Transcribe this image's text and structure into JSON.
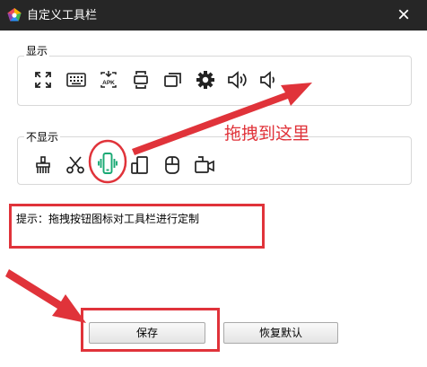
{
  "window": {
    "title": "自定义工具栏",
    "close_glyph": "×"
  },
  "show_group": {
    "label": "显示",
    "icons": [
      "fullscreen-icon",
      "keyboard-icon",
      "apk-install-icon",
      "screen-rotate-icon",
      "multi-window-icon",
      "settings-icon",
      "volume-up-icon",
      "volume-down-icon"
    ]
  },
  "hide_group": {
    "label": "不显示",
    "icons": [
      "clean-brush-icon",
      "scissors-icon",
      "vibrate-phone-icon",
      "tablet-phone-icon",
      "storage-icon",
      "video-record-icon"
    ]
  },
  "tip": "提示：拖拽按钮图标对工具栏进行定制",
  "annotation": {
    "drag_hint": "拖拽到这里",
    "color": "#e0333a"
  },
  "buttons": {
    "save": "保存",
    "restore": "恢复默认"
  },
  "colors": {
    "titlebar": "#262626",
    "accent_green": "#19a974",
    "annotation_red": "#e0333a"
  }
}
